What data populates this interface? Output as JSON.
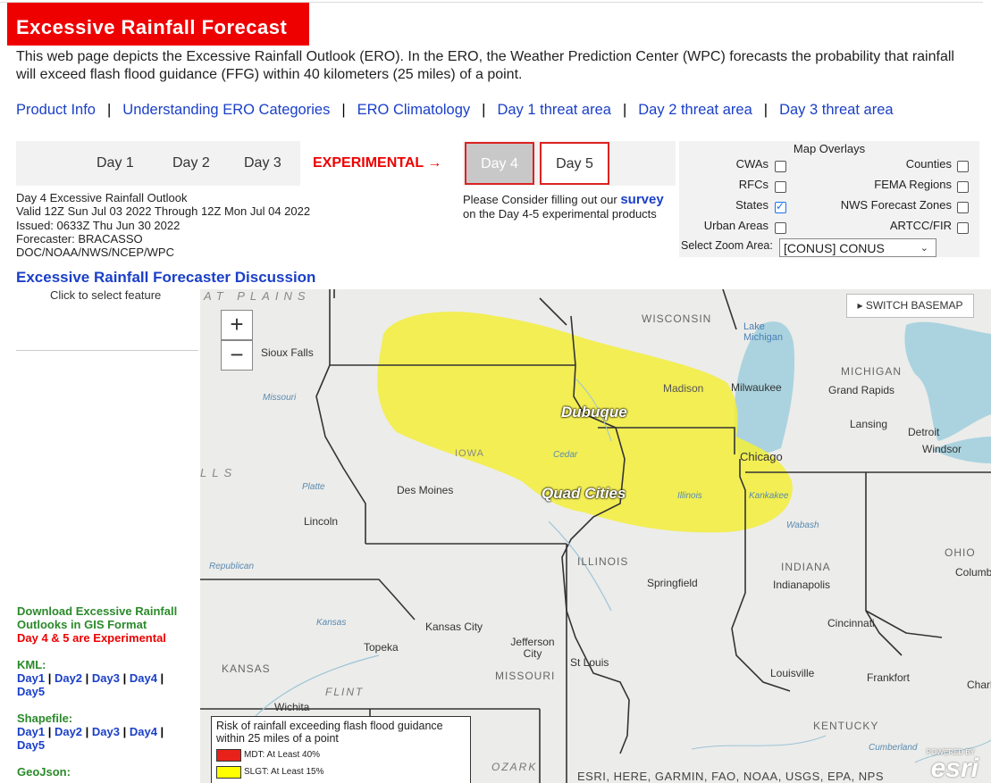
{
  "header": {
    "title": "Excessive Rainfall Forecast",
    "intro": "This web page depicts the Excessive Rainfall Outlook (ERO). In the ERO, the Weather Prediction Center (WPC) forecasts the probability that rainfall will exceed flash flood guidance (FFG) within 40 kilometers (25 miles) of a point."
  },
  "nav": {
    "links": [
      "Product Info",
      "Understanding ERO Categories",
      "ERO Climatology",
      "Day 1 threat area",
      "Day 2 threat area",
      "Day 3 threat area"
    ],
    "separator": "|"
  },
  "day_tabs": [
    "Day 1",
    "Day 2",
    "Day 3"
  ],
  "experimental_label": "EXPERIMENTAL →",
  "experimental_tabs": {
    "selected": "Day 4",
    "other": "Day 5"
  },
  "survey": {
    "prefix": "Please Consider filling out our",
    "link": "survey",
    "suffix": "on the Day 4-5 experimental products"
  },
  "outlook_meta": [
    "Day 4 Excessive Rainfall Outlook",
    "Valid 12Z Sun Jul 03 2022 Through 12Z Mon Jul 04 2022",
    "Issued: 0633Z Thu Jun 30 2022",
    "Forecaster: BRACASSO",
    "DOC/NOAA/NWS/NCEP/WPC"
  ],
  "overlays": {
    "title": "Map Overlays",
    "items": [
      {
        "label": "CWAs",
        "checked": false
      },
      {
        "label": "Counties",
        "checked": false
      },
      {
        "label": "RFCs",
        "checked": false
      },
      {
        "label": "FEMA Regions",
        "checked": false
      },
      {
        "label": "States",
        "checked": true
      },
      {
        "label": "NWS Forecast Zones",
        "checked": false
      },
      {
        "label": "Urban Areas",
        "checked": false
      },
      {
        "label": "ARTCC/FIR",
        "checked": false
      }
    ],
    "zoom_label": "Select Zoom Area:",
    "zoom_value": "[CONUS] CONUS"
  },
  "discussion_link": "Excessive Rainfall Forecaster Discussion",
  "click_note": "Click to select feature",
  "downloads": {
    "title_line1": "Download Excessive Rainfall",
    "title_line2": "Outlooks in GIS Format",
    "note": "Day 4 & 5 are Experimental",
    "kml_label": "KML:",
    "shapefile_label": "Shapefile:",
    "geojson_label": "GeoJson:",
    "day_links": [
      "Day1",
      "Day2",
      "Day3",
      "Day4",
      "Day5"
    ]
  },
  "map": {
    "zoom_in": "+",
    "zoom_out": "−",
    "switch_basemap": "▸ SWITCH BASEMAP",
    "attribution": "ESRI, HERE, GARMIN, FAO, NOAA, USGS, EPA, NPS",
    "powered_by": "POWERED BY",
    "esri_logo": "esri",
    "threat_labels": [
      "Dubuque",
      "Quad Cities"
    ],
    "place_labels": [
      "Sioux Falls",
      "WISCONSIN",
      "Lake Michigan",
      "Madison",
      "Milwaukee",
      "MICHIGAN",
      "Grand Rapids",
      "Lansing",
      "Detroit",
      "Windsor",
      "Chicago",
      "IOWA",
      "Des Moines",
      "Lincoln",
      "ILLINOIS",
      "INDIANA",
      "Springfield",
      "Indianapolis",
      "OHIO",
      "Columbus",
      "Kansas City",
      "Topeka",
      "KANSAS",
      "Jefferson City",
      "MISSOURI",
      "St Louis",
      "Cincinnati",
      "Louisville",
      "Frankfort",
      "KENTUCKY",
      "Wichita",
      "FLINT",
      "OZARK",
      "Charleston",
      "AT PLAINS",
      "LLS",
      "Platte",
      "Republican",
      "Missouri",
      "Kansas",
      "Cedar",
      "Wabash",
      "Kankakee",
      "Illinois",
      "Cumberland"
    ],
    "legend": {
      "title": "Risk of rainfall exceeding flash flood guidance within 25 miles of a point",
      "items": [
        {
          "label": "MDT: At Least 40%",
          "color": "#e8221b"
        },
        {
          "label": "SLGT: At Least 15%",
          "color": "#ffff00"
        }
      ]
    },
    "threat_color": "#ffff00",
    "threat_fill": "#f3ef3a"
  }
}
